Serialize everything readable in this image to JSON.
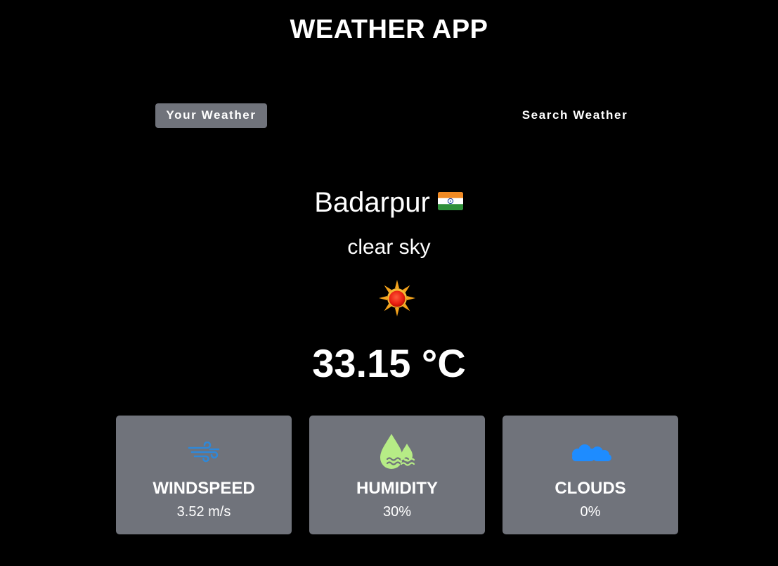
{
  "app": {
    "title": "WEATHER APP"
  },
  "tabs": [
    {
      "label": "Your Weather",
      "active": true
    },
    {
      "label": "Search Weather",
      "active": false
    }
  ],
  "location": {
    "city": "Badarpur",
    "country_flag_icon": "india-flag-icon"
  },
  "weather": {
    "description": "clear sky",
    "icon": "sun-icon",
    "temperature": "33.15 °C"
  },
  "stats": [
    {
      "label": "WINDSPEED",
      "value": "3.52 m/s",
      "icon": "wind-icon"
    },
    {
      "label": "HUMIDITY",
      "value": "30%",
      "icon": "humidity-drops-icon"
    },
    {
      "label": "CLOUDS",
      "value": "0%",
      "icon": "clouds-icon"
    }
  ],
  "colors": {
    "background": "#000000",
    "tab_active_bg": "#70737b",
    "card_bg": "#70737b",
    "wind_icon": "#2f88d8",
    "humidity_icon": "#b6ec86",
    "clouds_icon": "#1e8cff"
  }
}
